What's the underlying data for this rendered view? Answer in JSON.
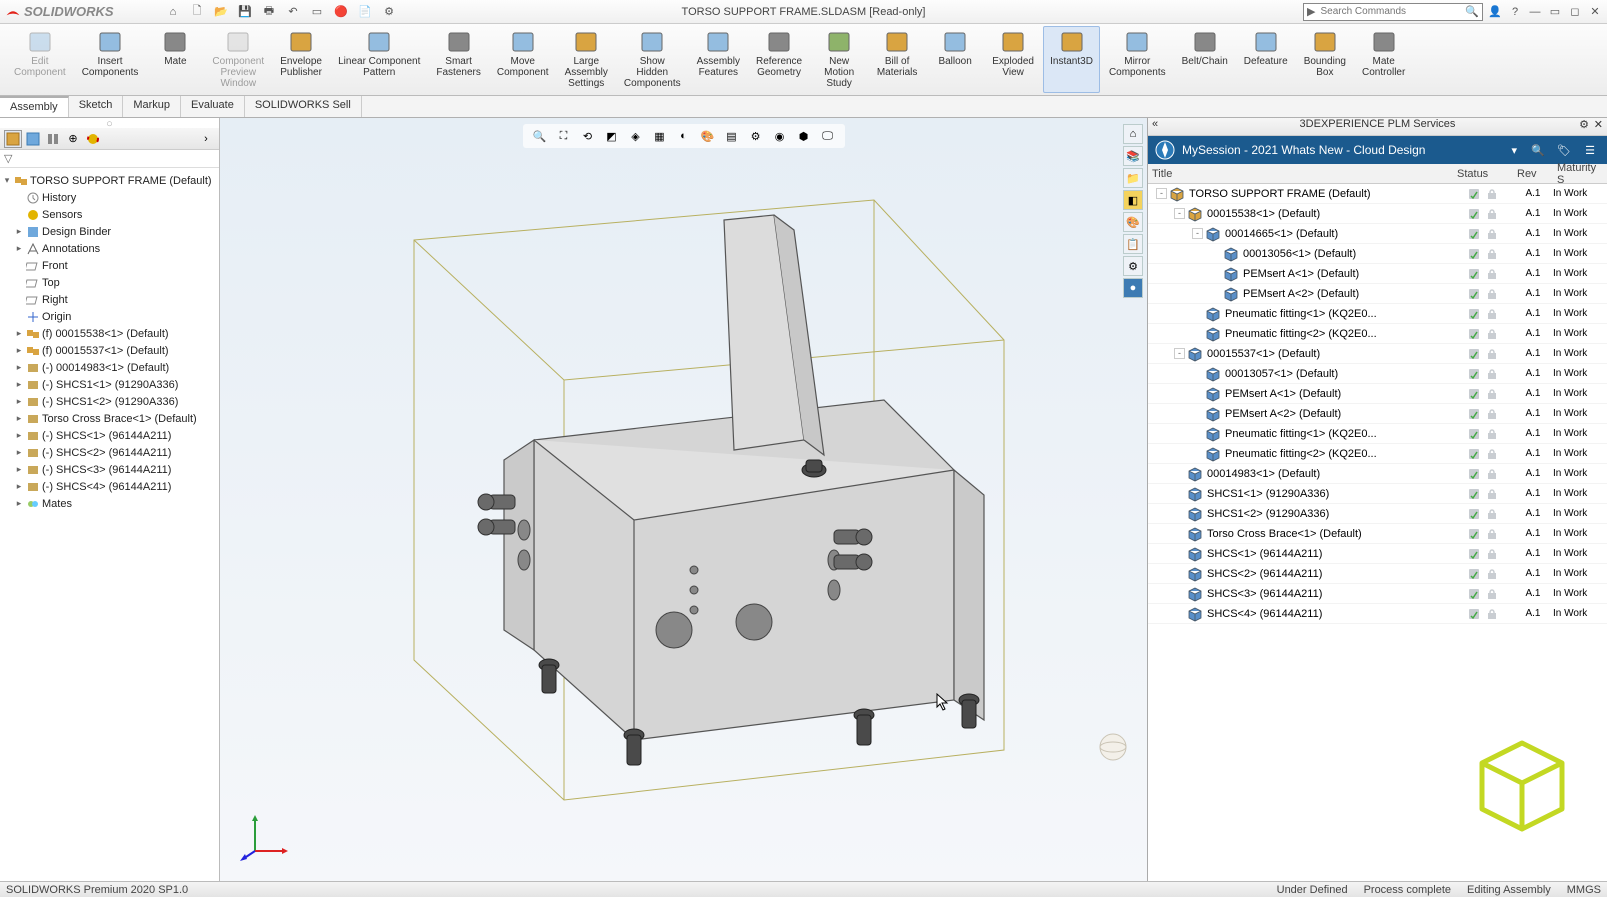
{
  "app": {
    "logo_text": "SOLIDWORKS",
    "doc_title": "TORSO SUPPORT FRAME.SLDASM [Read-only]",
    "search_placeholder": "Search Commands"
  },
  "ribbon": [
    {
      "label": "Edit\nComponent",
      "disabled": true
    },
    {
      "label": "Insert\nComponents"
    },
    {
      "label": "Mate"
    },
    {
      "label": "Component\nPreview\nWindow",
      "disabled": true
    },
    {
      "label": "Envelope\nPublisher"
    },
    {
      "label": "Linear Component\nPattern"
    },
    {
      "label": "Smart\nFasteners"
    },
    {
      "label": "Move\nComponent"
    },
    {
      "label": "Large\nAssembly\nSettings"
    },
    {
      "label": "Show\nHidden\nComponents"
    },
    {
      "label": "Assembly\nFeatures"
    },
    {
      "label": "Reference\nGeometry"
    },
    {
      "label": "New\nMotion\nStudy"
    },
    {
      "label": "Bill of\nMaterials"
    },
    {
      "label": "Balloon"
    },
    {
      "label": "Exploded\nView"
    },
    {
      "label": "Instant3D",
      "active": true
    },
    {
      "label": "Mirror\nComponents"
    },
    {
      "label": "Belt/Chain"
    },
    {
      "label": "Defeature"
    },
    {
      "label": "Bounding\nBox"
    },
    {
      "label": "Mate\nController"
    }
  ],
  "tabs": [
    "Assembly",
    "Sketch",
    "Markup",
    "Evaluate",
    "SOLIDWORKS Sell"
  ],
  "active_tab": 0,
  "feature_tree_root": "TORSO SUPPORT FRAME  (Default)",
  "feature_tree": [
    {
      "label": "History",
      "icon": "hist",
      "indent": 1
    },
    {
      "label": "Sensors",
      "icon": "sens",
      "indent": 1
    },
    {
      "label": "Design Binder",
      "icon": "bind",
      "indent": 1,
      "exp": "▸"
    },
    {
      "label": "Annotations",
      "icon": "anno",
      "indent": 1,
      "exp": "▸"
    },
    {
      "label": "Front",
      "icon": "plane",
      "indent": 1
    },
    {
      "label": "Top",
      "icon": "plane",
      "indent": 1
    },
    {
      "label": "Right",
      "icon": "plane",
      "indent": 1
    },
    {
      "label": "Origin",
      "icon": "orig",
      "indent": 1
    },
    {
      "label": "(f) 00015538<1> (Default)",
      "icon": "asm",
      "indent": 1,
      "exp": "▸"
    },
    {
      "label": "(f) 00015537<1> (Default)",
      "icon": "asm",
      "indent": 1,
      "exp": "▸"
    },
    {
      "label": "(-) 00014983<1> (Default)",
      "icon": "part",
      "indent": 1,
      "exp": "▸"
    },
    {
      "label": "(-) SHCS1<1> (91290A336)",
      "icon": "part",
      "indent": 1,
      "exp": "▸"
    },
    {
      "label": "(-) SHCS1<2> (91290A336)",
      "icon": "part",
      "indent": 1,
      "exp": "▸"
    },
    {
      "label": "Torso Cross Brace<1> (Default)",
      "icon": "part",
      "indent": 1,
      "exp": "▸"
    },
    {
      "label": "(-) SHCS<1> (96144A211)",
      "icon": "part",
      "indent": 1,
      "exp": "▸"
    },
    {
      "label": "(-) SHCS<2> (96144A211)",
      "icon": "part",
      "indent": 1,
      "exp": "▸"
    },
    {
      "label": "(-) SHCS<3> (96144A211)",
      "icon": "part",
      "indent": 1,
      "exp": "▸"
    },
    {
      "label": "(-) SHCS<4> (96144A211)",
      "icon": "part",
      "indent": 1,
      "exp": "▸"
    },
    {
      "label": "Mates",
      "icon": "mate",
      "indent": 1,
      "exp": "▸"
    }
  ],
  "right_panel": {
    "title": "3DEXPERIENCE PLM Services",
    "session": "MySession - 2021 Whats New - Cloud Design",
    "columns": [
      "Title",
      "Status",
      "Rev",
      "Maturity S"
    ],
    "rows": [
      {
        "indent": 0,
        "exp": "-",
        "label": "TORSO SUPPORT FRAME (Default)",
        "rev": "A.1",
        "mat": "In Work",
        "c": "#d9a441"
      },
      {
        "indent": 1,
        "exp": "-",
        "label": "00015538<1> (Default)",
        "rev": "A.1",
        "mat": "In Work",
        "c": "#d9a441"
      },
      {
        "indent": 2,
        "exp": "-",
        "label": "00014665<1> (Default)",
        "rev": "A.1",
        "mat": "In Work",
        "c": "#5a8fc8"
      },
      {
        "indent": 3,
        "exp": "",
        "label": "00013056<1> (Default)",
        "rev": "A.1",
        "mat": "In Work",
        "c": "#5a8fc8"
      },
      {
        "indent": 3,
        "exp": "",
        "label": "PEMsert A<1> (Default)",
        "rev": "A.1",
        "mat": "In Work",
        "c": "#5a8fc8"
      },
      {
        "indent": 3,
        "exp": "",
        "label": "PEMsert A<2> (Default)",
        "rev": "A.1",
        "mat": "In Work",
        "c": "#5a8fc8"
      },
      {
        "indent": 2,
        "exp": "",
        "label": "Pneumatic fitting<1> (KQ2E0...",
        "rev": "A.1",
        "mat": "In Work",
        "c": "#5a8fc8"
      },
      {
        "indent": 2,
        "exp": "",
        "label": "Pneumatic fitting<2> (KQ2E0...",
        "rev": "A.1",
        "mat": "In Work",
        "c": "#5a8fc8"
      },
      {
        "indent": 1,
        "exp": "-",
        "label": "00015537<1> (Default)",
        "rev": "A.1",
        "mat": "In Work",
        "c": "#5a8fc8"
      },
      {
        "indent": 2,
        "exp": "",
        "label": "00013057<1> (Default)",
        "rev": "A.1",
        "mat": "In Work",
        "c": "#5a8fc8"
      },
      {
        "indent": 2,
        "exp": "",
        "label": "PEMsert A<1> (Default)",
        "rev": "A.1",
        "mat": "In Work",
        "c": "#5a8fc8"
      },
      {
        "indent": 2,
        "exp": "",
        "label": "PEMsert A<2> (Default)",
        "rev": "A.1",
        "mat": "In Work",
        "c": "#5a8fc8"
      },
      {
        "indent": 2,
        "exp": "",
        "label": "Pneumatic fitting<1> (KQ2E0...",
        "rev": "A.1",
        "mat": "In Work",
        "c": "#5a8fc8"
      },
      {
        "indent": 2,
        "exp": "",
        "label": "Pneumatic fitting<2> (KQ2E0...",
        "rev": "A.1",
        "mat": "In Work",
        "c": "#5a8fc8"
      },
      {
        "indent": 1,
        "exp": "",
        "label": "00014983<1> (Default)",
        "rev": "A.1",
        "mat": "In Work",
        "c": "#5a8fc8"
      },
      {
        "indent": 1,
        "exp": "",
        "label": "SHCS1<1> (91290A336)",
        "rev": "A.1",
        "mat": "In Work",
        "c": "#5a8fc8"
      },
      {
        "indent": 1,
        "exp": "",
        "label": "SHCS1<2> (91290A336)",
        "rev": "A.1",
        "mat": "In Work",
        "c": "#5a8fc8"
      },
      {
        "indent": 1,
        "exp": "",
        "label": "Torso Cross Brace<1> (Default)",
        "rev": "A.1",
        "mat": "In Work",
        "c": "#5a8fc8"
      },
      {
        "indent": 1,
        "exp": "",
        "label": "SHCS<1> (96144A211)",
        "rev": "A.1",
        "mat": "In Work",
        "c": "#5a8fc8"
      },
      {
        "indent": 1,
        "exp": "",
        "label": "SHCS<2> (96144A211)",
        "rev": "A.1",
        "mat": "In Work",
        "c": "#5a8fc8"
      },
      {
        "indent": 1,
        "exp": "",
        "label": "SHCS<3> (96144A211)",
        "rev": "A.1",
        "mat": "In Work",
        "c": "#5a8fc8"
      },
      {
        "indent": 1,
        "exp": "",
        "label": "SHCS<4> (96144A211)",
        "rev": "A.1",
        "mat": "In Work",
        "c": "#5a8fc8"
      }
    ]
  },
  "status": {
    "left": "SOLIDWORKS Premium 2020 SP1.0",
    "right1": "Under Defined",
    "right2": "Process complete",
    "right3": "Editing Assembly",
    "units": "MMGS"
  }
}
